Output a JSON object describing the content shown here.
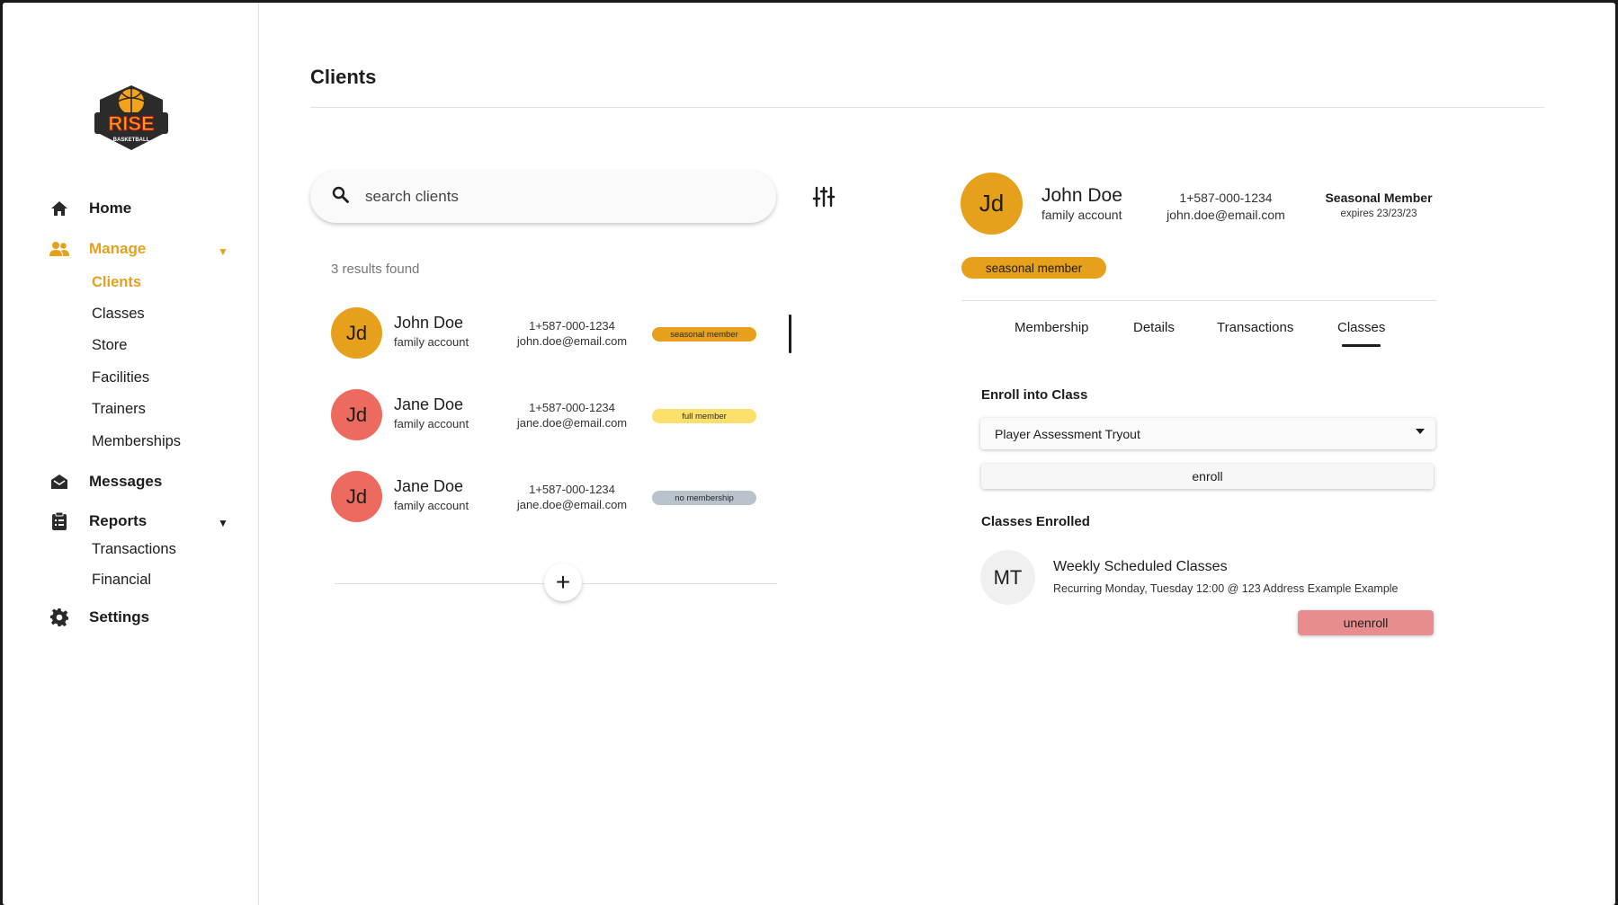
{
  "brand": {
    "name": "RISE",
    "tagline": "BASKETBALL",
    "accent": "#e6a01c"
  },
  "sidebar": {
    "home": "Home",
    "manage": "Manage",
    "manage_items": [
      "Clients",
      "Classes",
      "Store",
      "Facilities",
      "Trainers",
      "Memberships"
    ],
    "messages": "Messages",
    "reports": "Reports",
    "reports_items": [
      "Transactions",
      "Financial"
    ],
    "settings": "Settings"
  },
  "page": {
    "title": "Clients"
  },
  "search": {
    "placeholder": "search clients"
  },
  "results_text": "3 results found",
  "clients": [
    {
      "initials": "Jd",
      "name": "John Doe",
      "account": "family account",
      "phone": "1+587-000-1234",
      "email": "john.doe@email.com",
      "status": "seasonal member",
      "avatar_color": "#e6a01c",
      "badge_color": "#e6a01c"
    },
    {
      "initials": "Jd",
      "name": "Jane Doe",
      "account": "family account",
      "phone": "1+587-000-1234",
      "email": "jane.doe@email.com",
      "status": "full member",
      "avatar_color": "#ec6b5e",
      "badge_color": "#fce06b"
    },
    {
      "initials": "Jd",
      "name": "Jane Doe",
      "account": "family account",
      "phone": "1+587-000-1234",
      "email": "jane.doe@email.com",
      "status": "no membership",
      "avatar_color": "#ec6b5e",
      "badge_color": "#b8c3cc"
    }
  ],
  "detail": {
    "initials": "Jd",
    "name": "John Doe",
    "account": "family account",
    "phone": "1+587-000-1234",
    "email": "john.doe@email.com",
    "plan": "Seasonal Member",
    "expires": "expires 23/23/23",
    "badge": "seasonal member",
    "tabs": [
      "Membership",
      "Details",
      "Transactions",
      "Classes"
    ],
    "active_tab": "Classes",
    "enroll_label": "Enroll into Class",
    "enroll_selected": "Player Assessment Tryout",
    "enroll_button": "enroll",
    "enrolled_label": "Classes Enrolled",
    "enrolled": [
      {
        "initials": "MT",
        "title": "Weekly Scheduled Classes",
        "schedule": "Recurring Monday, Tuesday 12:00 @ 123 Address Example Example",
        "action": "unenroll"
      }
    ]
  }
}
